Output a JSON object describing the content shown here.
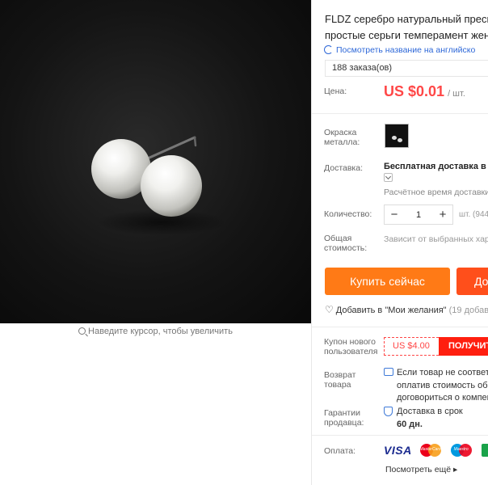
{
  "product": {
    "title_line1": "FLDZ серебро натуральный пресн",
    "title_line2": "простые серьги темперамент жен",
    "translate_link": "Посмотреть название на английско",
    "orders": "188 заказа(ов)"
  },
  "gallery": {
    "zoom_hint": "Наведите курсор, чтобы увеличить",
    "image_subject": "pearl stud earrings on dark background"
  },
  "price": {
    "label": "Цена:",
    "value": "US $0.01",
    "per_unit": "/ шт."
  },
  "color": {
    "label_line1": "Окраска",
    "label_line2": "металла:"
  },
  "shipping": {
    "label": "Доставка:",
    "method": "Бесплатная доставка в R",
    "estimate": "Расчётное время доставки"
  },
  "quantity": {
    "label": "Количество:",
    "minus": "−",
    "value": "1",
    "plus": "+",
    "unit": "шт. (944"
  },
  "total": {
    "label_line1": "Общая",
    "label_line2": "стоимость:",
    "text": "Зависит от выбранных хар"
  },
  "actions": {
    "buy_now": "Купить сейчас",
    "add_to_cart": "До",
    "wishlist": "Добавить в \"Мои желания\"",
    "wishlist_count": "(19 добав"
  },
  "coupon": {
    "label_line1": "Купон нового",
    "label_line2": "пользователя",
    "value": "US $4.00",
    "get": "ПОЛУЧИТ"
  },
  "returns": {
    "label_line1": "Возврат",
    "label_line2": "товара",
    "line1": "Если товар не соответс",
    "line2": "оплатив стоимость обр",
    "line3": "договориться о компен"
  },
  "guarantee": {
    "label_line1": "Гарантии",
    "label_line2": "продавца:",
    "line1": "Доставка в срок",
    "line2": "60 дн."
  },
  "payment": {
    "label": "Оплата:",
    "visa": "VISA",
    "mastercard": "MasterCard",
    "maestro": "Maestro",
    "more": "Посмотреть ещё ▸"
  },
  "colors": {
    "price": "#ff4747",
    "buy_button": "#ff7a16",
    "cart_button": "#ff4f1b",
    "coupon_get": "#ff1f0f",
    "link": "#2e68d8"
  }
}
